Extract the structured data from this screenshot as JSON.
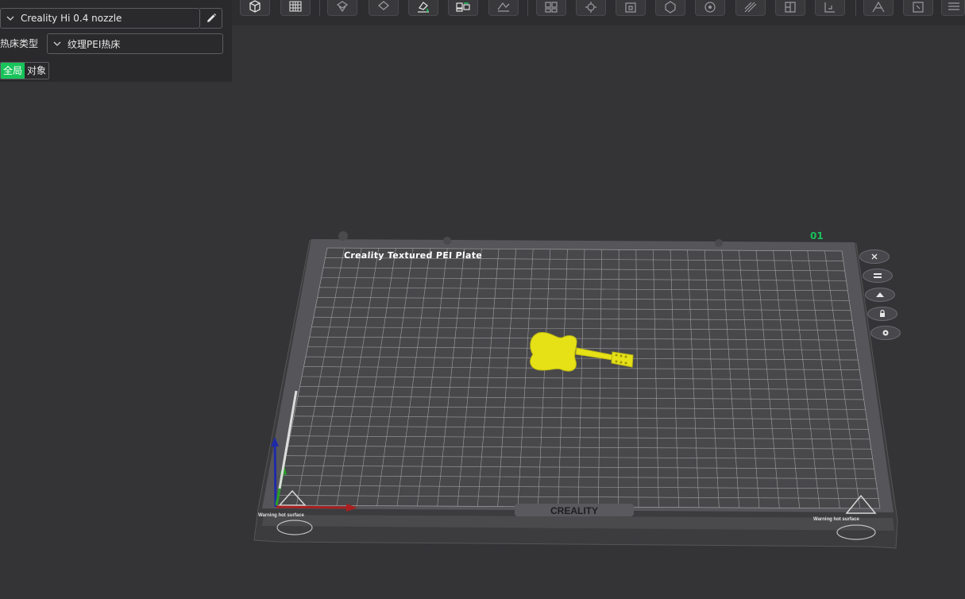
{
  "panel": {
    "printer_name": "Creality Hi 0.4 nozzle",
    "bed_type_label": "热床类型",
    "bed_type_value": "纹理PEI热床",
    "scope_tabs": [
      "全局",
      "对象"
    ],
    "scope_active": "全局"
  },
  "toolbar": {
    "buttons": [
      "add-cube-icon",
      "plate-grid-icon",
      "orient-icon",
      "arrange-icon",
      "lay-on-face-icon",
      "split-parts-icon",
      "cut-icon",
      "layout-icon",
      "assemble-icon",
      "hollow-icon",
      "support-paint-icon",
      "seam-paint-icon",
      "color-paint-icon",
      "measure-icon",
      "text-emboss-icon",
      "variable-layer-icon",
      "more-icon",
      "list-icon"
    ]
  },
  "scene": {
    "plate_label": "Creality Textured PEI Plate",
    "plate_number": "01",
    "bed_brand": "CREALITY",
    "warning_text": "Warning hot surface",
    "model_color": "#e6e017",
    "model_name": "guitar",
    "plate_controls": [
      "close-icon",
      "list-icon",
      "arrange-icon",
      "lock-icon",
      "settings-icon"
    ]
  },
  "colors": {
    "accent": "#17c35a",
    "background": "#343437",
    "panel": "#2a2a2c"
  }
}
